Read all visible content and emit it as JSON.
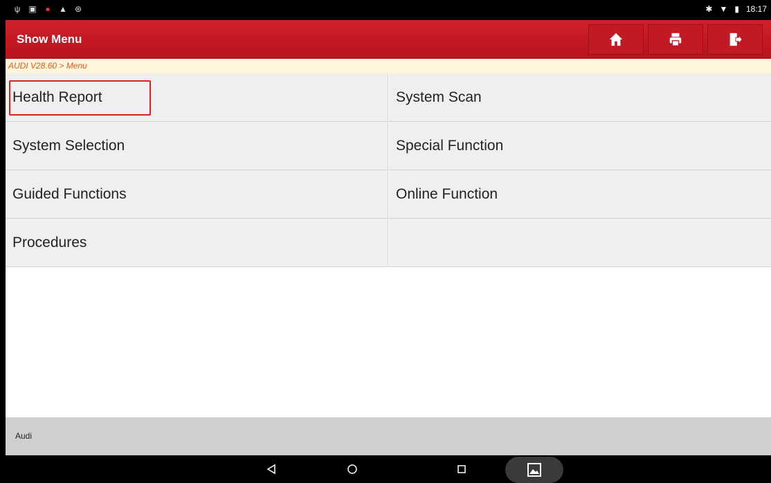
{
  "status_bar": {
    "left_icons": [
      "usb-icon",
      "screenshot-icon",
      "app-icon",
      "warning-icon",
      "settings-icon"
    ],
    "right_icons": [
      "bluetooth-icon",
      "wifi-icon",
      "battery-icon"
    ],
    "time": "18:17"
  },
  "header": {
    "title": "Show Menu",
    "buttons": [
      "home-icon",
      "print-icon",
      "exit-icon"
    ],
    "color": "#c8181f"
  },
  "breadcrumb": "AUDI V28.60 > Menu",
  "menu": {
    "items": [
      {
        "label": "Health Report",
        "highlighted": true
      },
      {
        "label": "System Scan"
      },
      {
        "label": "System Selection"
      },
      {
        "label": "Special Function"
      },
      {
        "label": "Guided Functions"
      },
      {
        "label": "Online Function"
      },
      {
        "label": "Procedures"
      },
      {
        "label": ""
      }
    ]
  },
  "footer": {
    "label": "Audi"
  },
  "nav_bar": {
    "buttons": [
      "back-icon",
      "home-circle-icon",
      "recent-apps-icon",
      "gallery-icon"
    ]
  }
}
